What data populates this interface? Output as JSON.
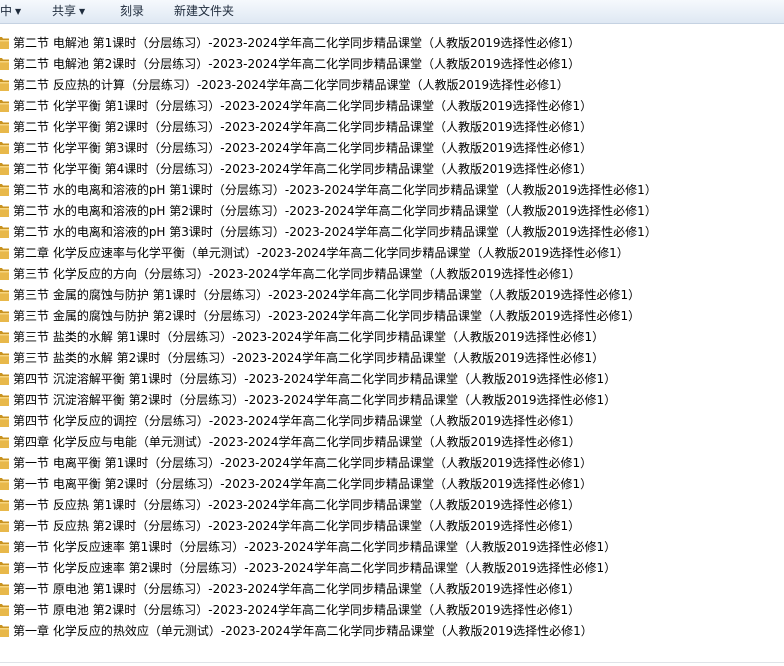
{
  "toolbar": {
    "items": [
      {
        "label": "中",
        "dropdown": true
      },
      {
        "label": "共享",
        "dropdown": true
      },
      {
        "label": "刻录",
        "dropdown": false
      },
      {
        "label": "新建文件夹",
        "dropdown": false
      }
    ]
  },
  "colors": {
    "folder": "#e8b84a",
    "folder_dark": "#c9931f"
  },
  "files": [
    "第二节 电解池 第1课时（分层练习）-2023-2024学年高二化学同步精品课堂（人教版2019选择性必修1）",
    "第二节 电解池 第2课时（分层练习）-2023-2024学年高二化学同步精品课堂（人教版2019选择性必修1）",
    "第二节 反应热的计算（分层练习）-2023-2024学年高二化学同步精品课堂（人教版2019选择性必修1）",
    "第二节 化学平衡 第1课时（分层练习）-2023-2024学年高二化学同步精品课堂（人教版2019选择性必修1）",
    "第二节 化学平衡 第2课时（分层练习）-2023-2024学年高二化学同步精品课堂（人教版2019选择性必修1）",
    "第二节 化学平衡 第3课时（分层练习）-2023-2024学年高二化学同步精品课堂（人教版2019选择性必修1）",
    "第二节 化学平衡 第4课时（分层练习）-2023-2024学年高二化学同步精品课堂（人教版2019选择性必修1）",
    "第二节 水的电离和溶液的pH 第1课时（分层练习）-2023-2024学年高二化学同步精品课堂（人教版2019选择性必修1）",
    "第二节 水的电离和溶液的pH 第2课时（分层练习）-2023-2024学年高二化学同步精品课堂（人教版2019选择性必修1）",
    "第二节 水的电离和溶液的pH 第3课时（分层练习）-2023-2024学年高二化学同步精品课堂（人教版2019选择性必修1）",
    "第二章 化学反应速率与化学平衡（单元测试）-2023-2024学年高二化学同步精品课堂（人教版2019选择性必修1）",
    "第三节 化学反应的方向（分层练习）-2023-2024学年高二化学同步精品课堂（人教版2019选择性必修1）",
    "第三节 金属的腐蚀与防护 第1课时（分层练习）-2023-2024学年高二化学同步精品课堂（人教版2019选择性必修1）",
    "第三节 金属的腐蚀与防护 第2课时（分层练习）-2023-2024学年高二化学同步精品课堂（人教版2019选择性必修1）",
    "第三节 盐类的水解 第1课时（分层练习）-2023-2024学年高二化学同步精品课堂（人教版2019选择性必修1）",
    "第三节 盐类的水解 第2课时（分层练习）-2023-2024学年高二化学同步精品课堂（人教版2019选择性必修1）",
    "第四节 沉淀溶解平衡 第1课时（分层练习）-2023-2024学年高二化学同步精品课堂（人教版2019选择性必修1）",
    "第四节 沉淀溶解平衡 第2课时（分层练习）-2023-2024学年高二化学同步精品课堂（人教版2019选择性必修1）",
    "第四节 化学反应的调控（分层练习）-2023-2024学年高二化学同步精品课堂（人教版2019选择性必修1）",
    "第四章 化学反应与电能（单元测试）-2023-2024学年高二化学同步精品课堂（人教版2019选择性必修1）",
    "第一节 电离平衡 第1课时（分层练习）-2023-2024学年高二化学同步精品课堂（人教版2019选择性必修1）",
    "第一节 电离平衡 第2课时（分层练习）-2023-2024学年高二化学同步精品课堂（人教版2019选择性必修1）",
    "第一节 反应热 第1课时（分层练习）-2023-2024学年高二化学同步精品课堂（人教版2019选择性必修1）",
    "第一节 反应热 第2课时（分层练习）-2023-2024学年高二化学同步精品课堂（人教版2019选择性必修1）",
    "第一节 化学反应速率 第1课时（分层练习）-2023-2024学年高二化学同步精品课堂（人教版2019选择性必修1）",
    "第一节 化学反应速率 第2课时（分层练习）-2023-2024学年高二化学同步精品课堂（人教版2019选择性必修1）",
    "第一节 原电池 第1课时（分层练习）-2023-2024学年高二化学同步精品课堂（人教版2019选择性必修1）",
    "第一节 原电池 第2课时（分层练习）-2023-2024学年高二化学同步精品课堂（人教版2019选择性必修1）",
    "第一章 化学反应的热效应（单元测试）-2023-2024学年高二化学同步精品课堂（人教版2019选择性必修1）"
  ]
}
